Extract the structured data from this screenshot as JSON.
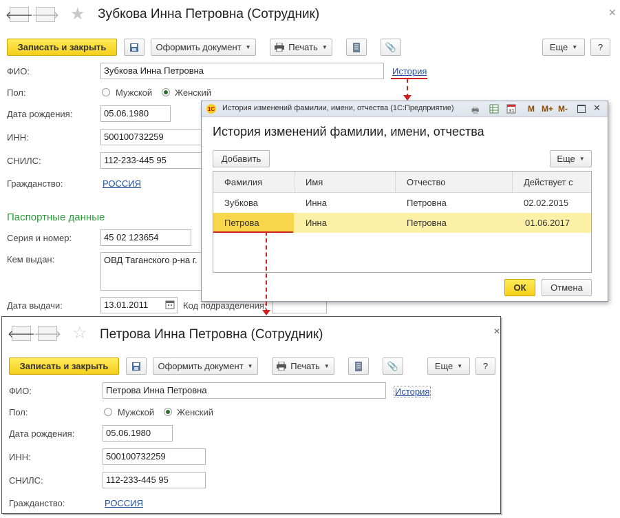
{
  "back_window": {
    "title": "Зубкова Инна Петровна (Сотрудник)",
    "toolbar": {
      "save_close": "Записать и закрыть",
      "make_doc": "Оформить документ",
      "print": "Печать",
      "more": "Еще",
      "help": "?"
    },
    "fields": {
      "fio_label": "ФИО:",
      "fio_value": "Зубкова Инна Петровна",
      "history_link": "История",
      "gender_label": "Пол:",
      "gender_male": "Мужской",
      "gender_female": "Женский",
      "birth_label": "Дата рождения:",
      "birth_value": "05.06.1980",
      "inn_label": "ИНН:",
      "inn_value": "500100732259",
      "snils_label": "СНИЛС:",
      "snils_value": "112-233-445 95",
      "citizenship_label": "Гражданство:",
      "citizenship_value": "РОССИЯ"
    },
    "passport": {
      "section_title": "Паспортные данные",
      "series_label": "Серия и номер:",
      "series_value": "45 02 123654",
      "issued_label": "Кем выдан:",
      "issued_value": "ОВД Таганского р-на г.",
      "date_label": "Дата выдачи:",
      "date_value": "13.01.2011",
      "code_label": "Код подразделения:"
    }
  },
  "dialog": {
    "caption": "История изменений фамилии, имени, отчества  (1С:Предприятие)",
    "caption_buttons": [
      "M",
      "M+",
      "M-"
    ],
    "heading": "История изменений фамилии, имени, отчества",
    "add_button": "Добавить",
    "more_button": "Еще",
    "columns": [
      "Фамилия",
      "Имя",
      "Отчество",
      "Действует с"
    ],
    "rows": [
      [
        "Зубкова",
        "Инна",
        "Петровна",
        "02.02.2015"
      ],
      [
        "Петрова",
        "Инна",
        "Петровна",
        "01.06.2017"
      ]
    ],
    "ok": "ОК",
    "cancel": "Отмена"
  },
  "front_window": {
    "title": "Петрова Инна Петровна (Сотрудник)",
    "toolbar": {
      "save_close": "Записать и закрыть",
      "make_doc": "Оформить документ",
      "print": "Печать",
      "more": "Еще",
      "help": "?"
    },
    "fields": {
      "fio_label": "ФИО:",
      "fio_value": "Петрова Инна Петровна",
      "history_link": "История",
      "gender_label": "Пол:",
      "gender_male": "Мужской",
      "gender_female": "Женский",
      "birth_label": "Дата рождения:",
      "birth_value": "05.06.1980",
      "inn_label": "ИНН:",
      "inn_value": "500100732259",
      "snils_label": "СНИЛС:",
      "snils_value": "112-233-445 95",
      "citizenship_label": "Гражданство:",
      "citizenship_value": "РОССИЯ"
    }
  },
  "colors": {
    "accent_yellow": "#f5cf1a",
    "selected_row": "#fbf0a6",
    "link_blue": "#1f4f9f",
    "section_green": "#2b9a3a",
    "annotation_red": "#cc1f1f"
  }
}
